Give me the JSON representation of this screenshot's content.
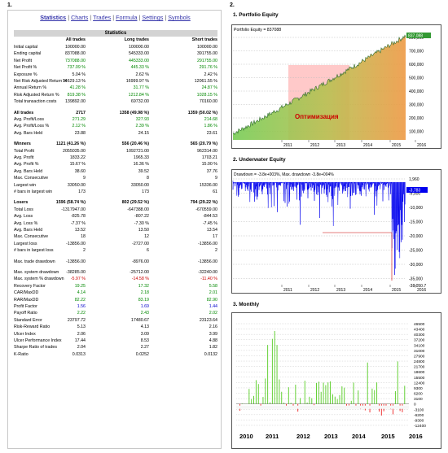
{
  "sections": {
    "s1_num": "1.",
    "s2_num": "2.",
    "s2_title": "1. Portfolio Equity",
    "s3_title": "2. Underwater Equity",
    "s4_title": "3. Monthly"
  },
  "nav": {
    "items": [
      "Statistics",
      "Charts",
      "Trades",
      "Formula",
      "Settings",
      "Symbols"
    ],
    "active": "Statistics"
  },
  "stats": {
    "title": "Statistics",
    "headers": [
      "",
      "All trades",
      "Long trades",
      "Short trades"
    ],
    "rows": [
      {
        "label": "Initial capital",
        "c1": "100000.00",
        "c2": "100000.00",
        "c3": "100000.00"
      },
      {
        "label": "Ending capital",
        "c1": "837088.00",
        "c2": "545333.00",
        "c3": "391755.00"
      },
      {
        "label": "Net Profit",
        "c1": "737088.00",
        "c2": "445333.00",
        "c3": "291755.00",
        "color": "g"
      },
      {
        "label": "Net Profit %",
        "c1": "737.09 %",
        "c2": "445.33 %",
        "c3": "291.76 %",
        "color": "g"
      },
      {
        "label": "Exposure %",
        "c1": "5.04 %",
        "c2": "2.62 %",
        "c3": "2.42 %"
      },
      {
        "label": "Net Risk Adjusted Return %",
        "c1": "14629.13 %",
        "c2": "16999.97 %",
        "c3": "12061.55 %"
      },
      {
        "label": "Annual Return %",
        "c1": "41.28 %",
        "c2": "31.77 %",
        "c3": "24.87 %",
        "color": "g"
      },
      {
        "label": "Risk Adjusted Return %",
        "c1": "819.38 %",
        "c2": "1212.84 %",
        "c3": "1028.15 %",
        "color": "g"
      },
      {
        "label": "Total transaction costs",
        "c1": "139892.00",
        "c2": "69732.00",
        "c3": "70160.00"
      },
      {
        "blank": true
      },
      {
        "label": "All trades",
        "c1": "2717",
        "c2": "1358 (49.98 %)",
        "c3": "1359 (50.02 %)",
        "bold": true
      },
      {
        "label": "Avg. Profit/Loss",
        "c1": "271.29",
        "c2": "327.93",
        "c3": "214.68",
        "color": "g"
      },
      {
        "label": "Avg. Profit/Loss %",
        "c1": "2.12 %",
        "c2": "2.39 %",
        "c3": "1.86 %",
        "color": "g"
      },
      {
        "label": "Avg. Bars Held",
        "c1": "23.88",
        "c2": "24.15",
        "c3": "23.61"
      },
      {
        "blank": true
      },
      {
        "label": "Winners",
        "c1": "1121 (41.26 %)",
        "c2": "556 (20.46 %)",
        "c3": "565 (20.79 %)",
        "bold": true
      },
      {
        "label": "Total Profit",
        "c1": "2055035.00",
        "c2": "1092721.00",
        "c3": "962314.00"
      },
      {
        "label": "Avg. Profit",
        "c1": "1833.22",
        "c2": "1965.33",
        "c3": "1703.21"
      },
      {
        "label": "Avg. Profit %",
        "c1": "15.67 %",
        "c2": "16.36 %",
        "c3": "15.00 %"
      },
      {
        "label": "Avg. Bars Held",
        "c1": "38.60",
        "c2": "39.52",
        "c3": "37.76"
      },
      {
        "label": "Max. Consecutive",
        "c1": "9",
        "c2": "8",
        "c3": "9"
      },
      {
        "label": "Largest win",
        "c1": "33050.00",
        "c2": "33050.00",
        "c3": "15336.00"
      },
      {
        "label": "# bars in largest win",
        "c1": "173",
        "c2": "173",
        "c3": "61"
      },
      {
        "blank": true
      },
      {
        "label": "Losers",
        "c1": "1596 (58.74 %)",
        "c2": "802 (29.52 %)",
        "c3": "794 (29.22 %)",
        "bold": true
      },
      {
        "label": "Total Loss",
        "c1": "-1317947.00",
        "c2": "-647388.00",
        "c3": "-670559.00"
      },
      {
        "label": "Avg. Loss",
        "c1": "-825.78",
        "c2": "-807.22",
        "c3": "-844.53"
      },
      {
        "label": "Avg. Loss %",
        "c1": "-7.37 %",
        "c2": "-7.30 %",
        "c3": "-7.45 %"
      },
      {
        "label": "Avg. Bars Held",
        "c1": "13.52",
        "c2": "13.50",
        "c3": "13.54"
      },
      {
        "label": "Max. Consecutive",
        "c1": "18",
        "c2": "12",
        "c3": "17"
      },
      {
        "label": "Largest loss",
        "c1": "-13856.00",
        "c2": "-2727.00",
        "c3": "-13856.00"
      },
      {
        "label": "# bars in largest loss",
        "c1": "2",
        "c2": "6",
        "c3": "2"
      },
      {
        "blank": true
      },
      {
        "label": "Max. trade drawdown",
        "c1": "-13856.00",
        "c2": "-8976.00",
        "c3": "-13856.00"
      },
      {
        "blank": true
      },
      {
        "label": "Max. system drawdown",
        "c1": "-38285.00",
        "c2": "-25712.00",
        "c3": "-32240.00"
      },
      {
        "label": "Max. system % drawdown",
        "c1": "-5.97 %",
        "c2": "-14.58 %",
        "c3": "-11.40 %",
        "color": "r"
      },
      {
        "label": "Recovery Factor",
        "c1": "19.25",
        "c2": "17.32",
        "c3": "5.58",
        "color": "g"
      },
      {
        "label": "CAR/MaxDD",
        "c1": "4.14",
        "c2": "2.18",
        "c3": "2.01",
        "color": "g"
      },
      {
        "label": "RAR/MaxDD",
        "c1": "82.22",
        "c2": "83.19",
        "c3": "82.90",
        "color": "g"
      },
      {
        "label": "Profit Factor",
        "c1": "1.56",
        "c2": "1.69",
        "c3": "1.44",
        "color": "b"
      },
      {
        "label": "Payoff Ratio",
        "c1": "2.22",
        "c2": "2.43",
        "c3": "2.02",
        "color": "g"
      },
      {
        "label": "Standard Error",
        "c1": "23797.72",
        "c2": "17480.67",
        "c3": "23123.64"
      },
      {
        "label": "Risk-Reward Ratio",
        "c1": "5.13",
        "c2": "4.13",
        "c3": "2.16"
      },
      {
        "label": "Ulcer Index",
        "c1": "2.06",
        "c2": "3.09",
        "c3": "3.99"
      },
      {
        "label": "Ulcer Performance Index",
        "c1": "17.44",
        "c2": "8.53",
        "c3": "4.88"
      },
      {
        "label": "Sharpe Ratio of trades",
        "c1": "2.04",
        "c2": "2.27",
        "c3": "1.82"
      },
      {
        "label": "K-Ratio",
        "c1": "0.0313",
        "c2": "0.0252",
        "c3": "0.0132"
      }
    ]
  },
  "equity_chart": {
    "caption": "Portfolio Equity = 837088",
    "annotation": "Оптимизация",
    "last_value_tag": "837,088",
    "y_ticks": [
      "800,000",
      "700,000",
      "600,000",
      "500,000",
      "400,000",
      "300,000",
      "200,000",
      "100,000"
    ],
    "x_ticks": [
      "2011",
      "2012",
      "2013",
      "2014",
      "2015",
      "2016"
    ],
    "colors": {
      "fill_low": "#77cc55",
      "fill_high": "#ee9944",
      "line": "#2a6a2a",
      "highlight": "#ff8888",
      "tag": "#339933"
    }
  },
  "underwater_chart": {
    "caption": "Drawdown = -3.8e+003%, Max. drawdown -3.8e+004%",
    "min_tag": "-3,783",
    "bottom_tag": "-38,050.7",
    "y_ticks": [
      "1,960",
      "-5,000",
      "-10,000",
      "-15,000",
      "-20,000",
      "-25,000",
      "-30,000",
      "-35,000"
    ],
    "x_ticks": [
      "2011",
      "2012",
      "2013",
      "2014",
      "2015",
      "2016"
    ],
    "colors": {
      "line": "#0000ee",
      "flat": "#cc0000",
      "tag": "#0000ee"
    }
  },
  "monthly_chart": {
    "y_ticks": [
      "46500",
      "43400",
      "40300",
      "37200",
      "34100",
      "31000",
      "27900",
      "24800",
      "21700",
      "18600",
      "15500",
      "12400",
      "9300",
      "6200",
      "3100",
      "0",
      "-3100",
      "-6200",
      "-9300",
      "-12400"
    ],
    "x_ticks": [
      "2010",
      "2011",
      "2012",
      "2013",
      "2014",
      "2015",
      "2016"
    ],
    "colors": {
      "pos": "#55cc22",
      "neg": "#ee2222"
    }
  }
}
